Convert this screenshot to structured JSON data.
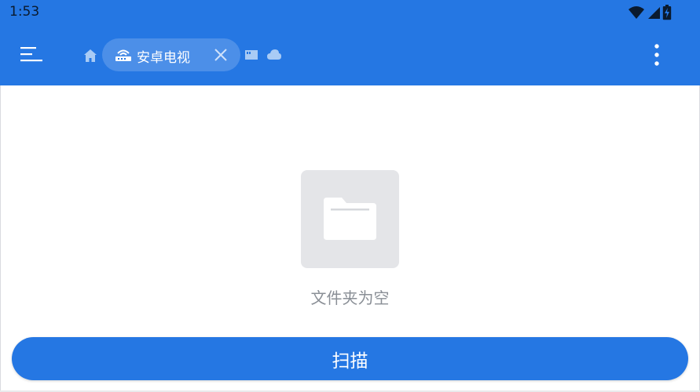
{
  "status_bar": {
    "time": "1:53",
    "icons": [
      "wifi-icon",
      "signal-icon",
      "battery-charging-icon"
    ]
  },
  "toolbar": {
    "menu_icon": "menu-icon",
    "home_icon": "home-icon",
    "current_location": {
      "icon": "router-icon",
      "label": "安卓电视",
      "close_icon": "close-icon"
    },
    "extra_icons": [
      "sd-card-icon",
      "cloud-icon"
    ],
    "more_icon": "more-vertical-icon"
  },
  "main": {
    "empty_icon": "folder-icon",
    "empty_text": "文件夹为空"
  },
  "footer": {
    "scan_label": "扫描"
  },
  "colors": {
    "primary": "#2577e3",
    "background": "#ffffff",
    "empty_tile": "#e4e5e8",
    "empty_text": "#8a8f96"
  }
}
